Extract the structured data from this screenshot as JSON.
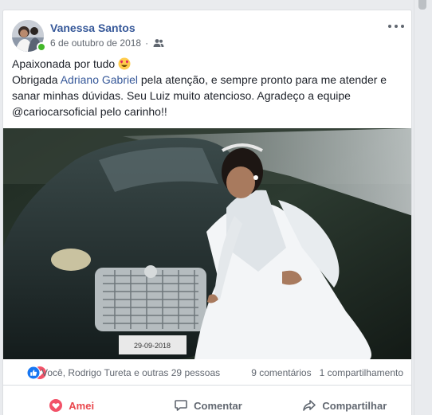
{
  "post": {
    "author": "Vanessa Santos",
    "date": "6 de outubro de 2018",
    "audience_icon": "friends-icon",
    "text_line1_prefix": "Apaixonada por tudo",
    "text_line2_prefix": "Obrigada",
    "mention": "Adriano Gabriel",
    "text_line2_rest": "pela atenção, e sempre pronto para me atender e sanar minhas dúvidas. Seu Luiz muito atencioso. Agradeço a equipe @cariocarsoficial pelo carinho!!",
    "emoji_icon": "heart-eyes-emoji-icon",
    "plate_text": "29-09-2018"
  },
  "reactions": {
    "summary": "Você, Rodrigo Tureta e outras 29 pessoas",
    "comments": "9 comentários",
    "shares": "1 compartilhamento",
    "icons": [
      "love-reaction-icon",
      "like-reaction-icon"
    ]
  },
  "actions": {
    "like_label": "Amei",
    "comment_label": "Comentar",
    "share_label": "Compartilhar"
  },
  "colors": {
    "link": "#365899",
    "love": "#e9484e",
    "like": "#1877f2",
    "online": "#42b72a"
  }
}
